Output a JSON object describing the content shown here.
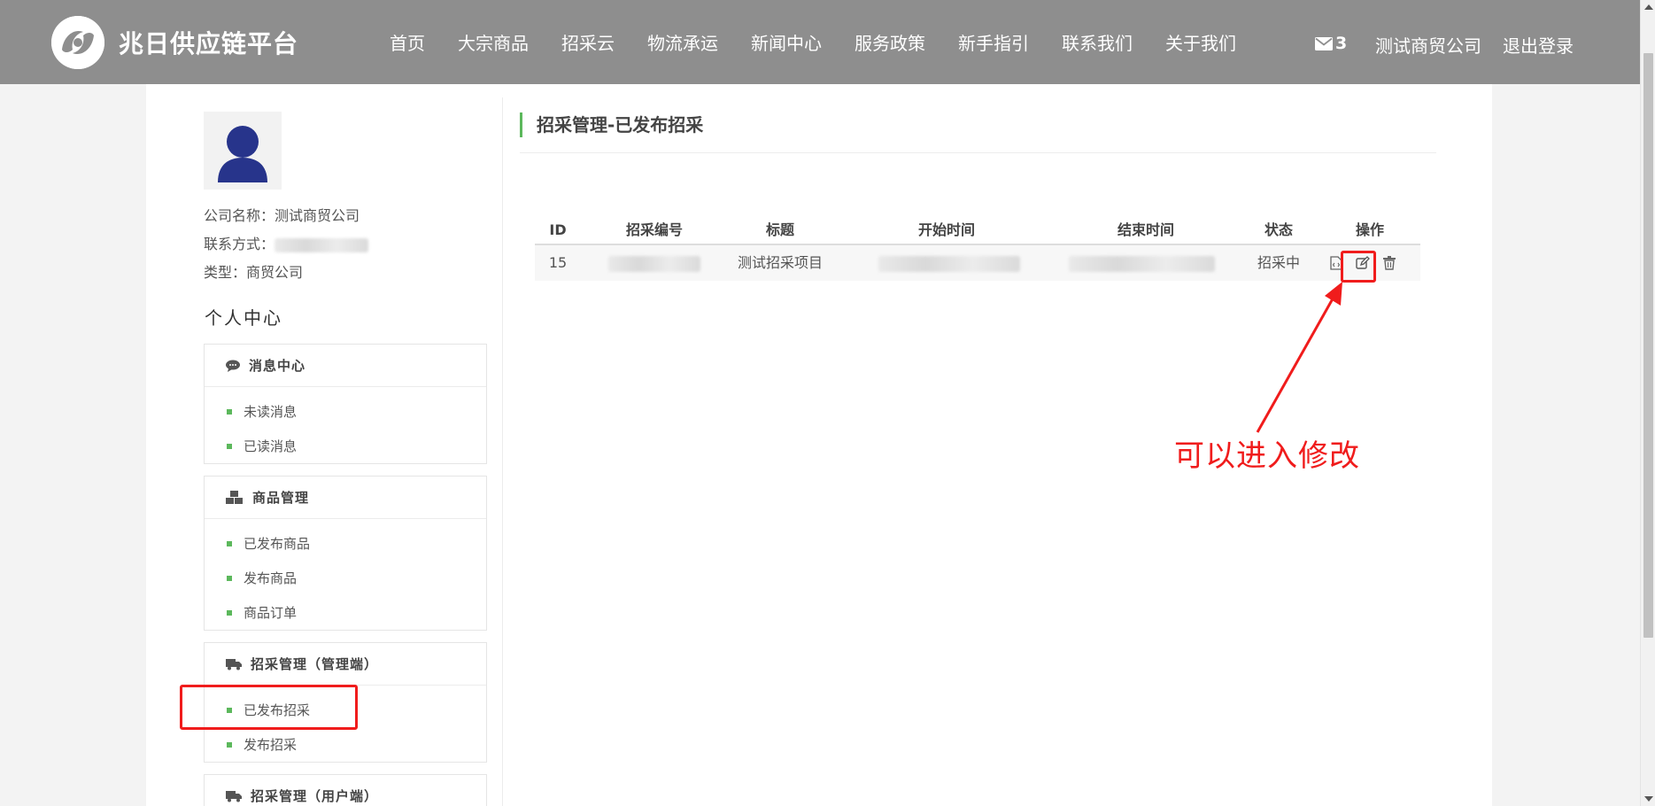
{
  "header": {
    "brand": "兆日供应链平台",
    "logo_icon": "brand-logo-icon",
    "nav": [
      "首页",
      "大宗商品",
      "招采云",
      "物流承运",
      "新闻中心",
      "服务政策",
      "新手指引",
      "联系我们",
      "关于我们"
    ],
    "mail_count": "3",
    "company": "测试商贸公司",
    "logout": "退出登录"
  },
  "profile": {
    "company_label": "公司名称：",
    "company_value": "测试商贸公司",
    "contact_label": "联系方式：",
    "type_label": "类型：",
    "type_value": "商贸公司"
  },
  "sidebar": {
    "title": "个人中心",
    "groups": [
      {
        "title": "消息中心",
        "icon": "comment-icon",
        "items": [
          "未读消息",
          "已读消息"
        ]
      },
      {
        "title": "商品管理",
        "icon": "cubes-icon",
        "items": [
          "已发布商品",
          "发布商品",
          "商品订单"
        ]
      },
      {
        "title": "招采管理（管理端）",
        "icon": "truck-icon",
        "items": [
          "已发布招采",
          "发布招采"
        ]
      },
      {
        "title": "招采管理（用户端）",
        "icon": "truck-icon",
        "items": []
      }
    ]
  },
  "main": {
    "title": "招采管理-已发布招采",
    "table": {
      "headers": [
        "ID",
        "招采编号",
        "标题",
        "开始时间",
        "结束时间",
        "状态",
        "操作"
      ],
      "rows": [
        {
          "id": "15",
          "title": "测试招采项目",
          "status": "招采中",
          "actions": [
            "view-icon",
            "edit-icon",
            "trash-icon"
          ]
        }
      ]
    }
  },
  "annotation": {
    "text": "可以进入修改",
    "color": "#f01c1c"
  },
  "colors": {
    "header_bg": "#8e8e8e",
    "accent_green": "#5cb85c",
    "avatar_blue": "#27348b"
  }
}
